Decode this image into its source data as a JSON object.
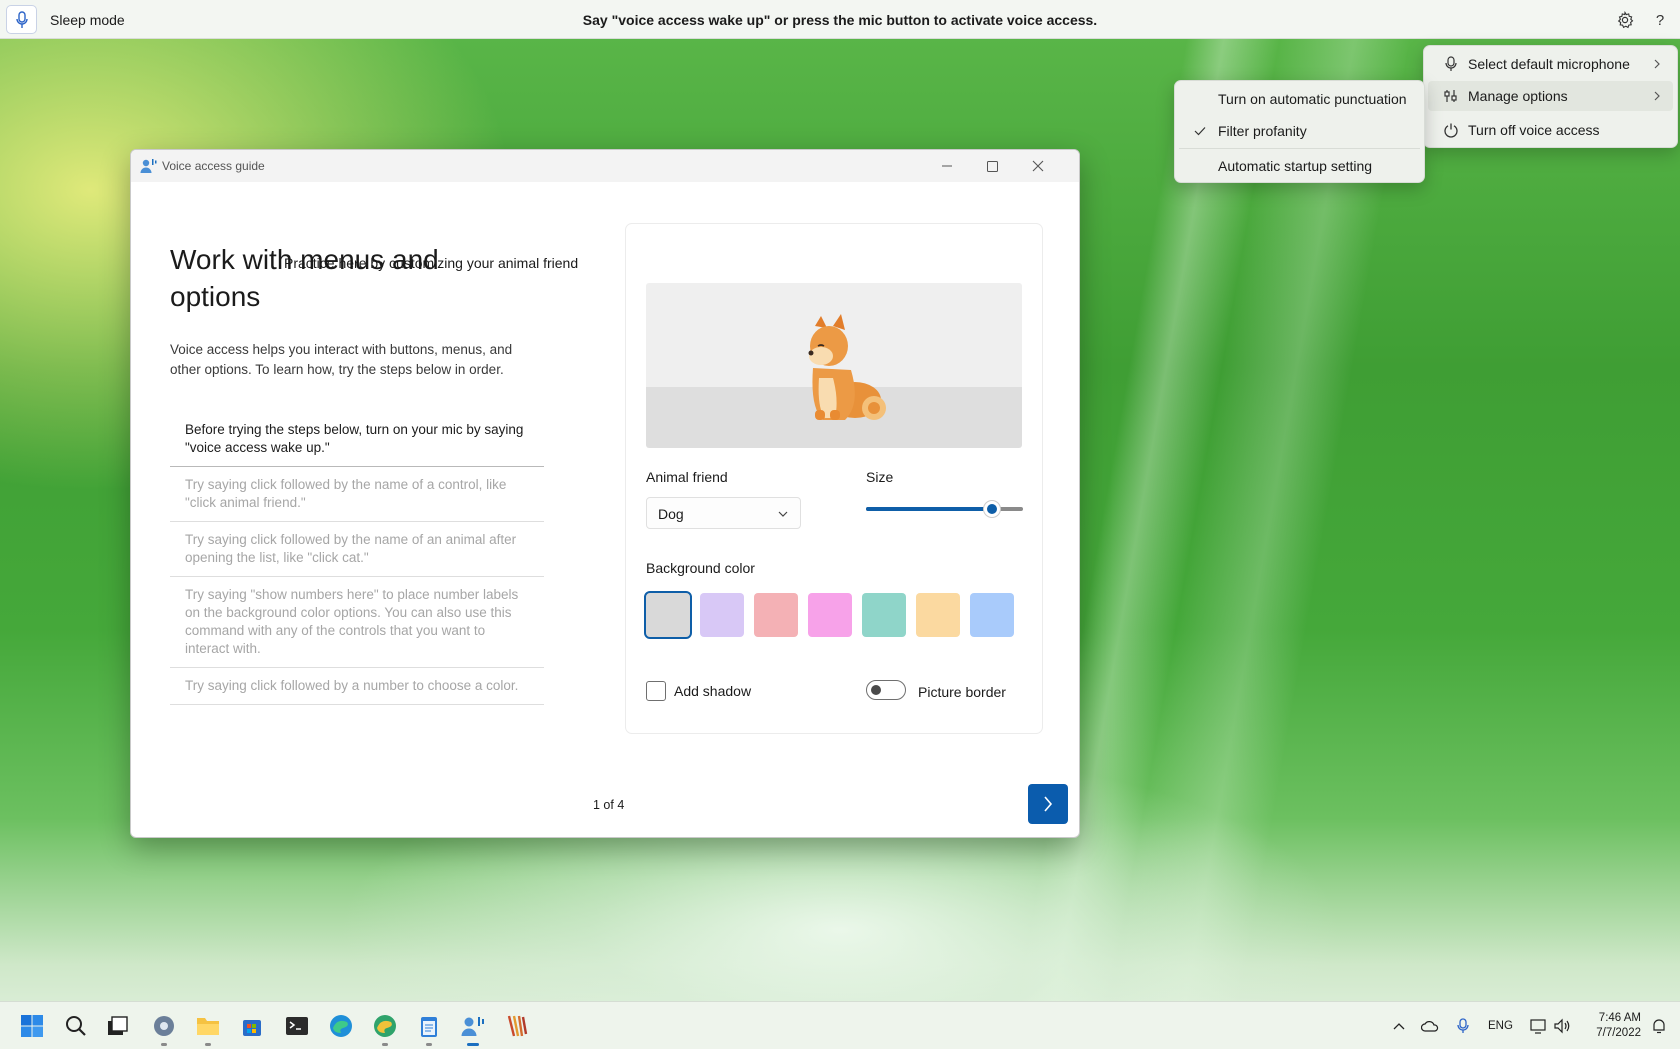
{
  "voice_bar": {
    "mode_label": "Sleep mode",
    "message": "Say \"voice access wake up\" or press the mic button to activate voice access.",
    "icons": [
      "mic-icon",
      "gear-icon",
      "help-icon"
    ]
  },
  "main_menu": {
    "items": [
      {
        "label": "Select default microphone",
        "icon": "mic-icon",
        "has_submenu": true
      },
      {
        "label": "Manage options",
        "icon": "settings-sliders-icon",
        "has_submenu": true
      },
      {
        "label": "Turn off voice access",
        "icon": "power-icon",
        "has_submenu": false
      }
    ]
  },
  "submenu": {
    "items": [
      {
        "label": "Turn on automatic punctuation",
        "checked": false
      },
      {
        "label": "Filter profanity",
        "checked": true
      },
      {
        "label": "Automatic startup setting",
        "checked": false
      }
    ]
  },
  "window": {
    "title": "Voice access guide",
    "heading": "Work with menus and options",
    "intro": "Voice access helps you interact with buttons, menus, and other options. To learn how, try the steps below in order.",
    "steps": [
      "Before trying the steps below, turn on your mic by saying \"voice access wake up.\"",
      "Try saying click followed by the name of a control, like \"click animal friend.\"",
      "Try saying click followed by the name of an animal after opening the list, like \"click cat.\"",
      "Try saying \"show numbers here\" to place number labels on the background color options. You can also use this command with any of the controls that you want to interact with.",
      "Try saying click followed by a number to choose a color."
    ],
    "practice": {
      "title": "Practice here by customizing your animal friend",
      "animal_label": "Animal friend",
      "animal_value": "Dog",
      "size_label": "Size",
      "size_value": 0.8,
      "bg_label": "Background color",
      "colors": [
        "#d9d9d9",
        "#d8c8f6",
        "#f4b1b5",
        "#f7a2e9",
        "#8fd5c9",
        "#fbd9a0",
        "#a9cbfb"
      ],
      "selected_color_index": 0,
      "shadow_label": "Add shadow",
      "shadow_checked": false,
      "border_label": "Picture border",
      "border_on": false
    },
    "pager": "1 of 4"
  },
  "taskbar": {
    "apps": [
      "start-icon",
      "search-icon",
      "task-view-icon",
      "settings-app-icon",
      "file-explorer-icon",
      "store-icon",
      "terminal-icon",
      "edge-icon",
      "edge-canary-icon",
      "notepad-icon",
      "voice-access-icon",
      "app-icon"
    ],
    "active_app": "voice-access-icon",
    "language": "ENG",
    "time": "7:46 AM",
    "date": "7/7/2022"
  }
}
